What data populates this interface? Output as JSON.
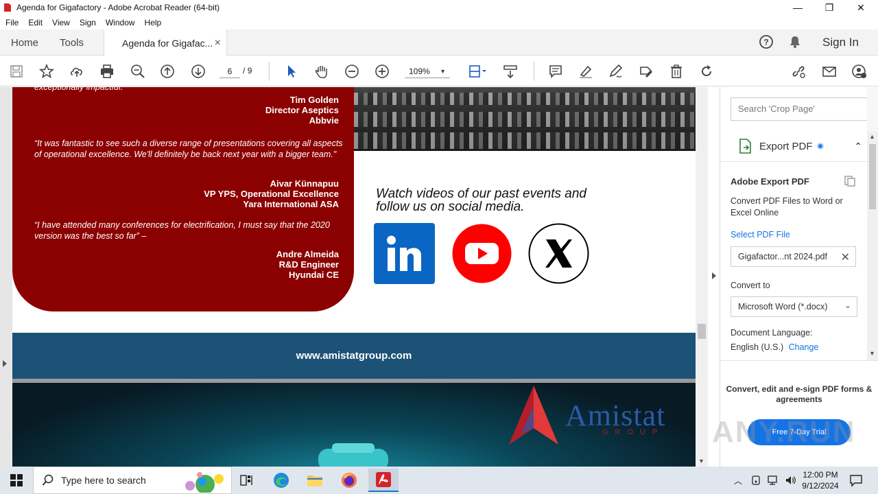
{
  "window": {
    "title": "Agenda for Gigafactory - Adobe Acrobat Reader (64-bit)",
    "minimize": "—",
    "maximize": "❐",
    "close": "✕"
  },
  "menu": [
    "File",
    "Edit",
    "View",
    "Sign",
    "Window",
    "Help"
  ],
  "tabs": {
    "home": "Home",
    "tools": "Tools",
    "document": "Agenda for Gigafac...",
    "close": "×",
    "sign_in": "Sign In"
  },
  "toolbar": {
    "current_page": "6",
    "page_separator": "/",
    "total_pages": "9",
    "zoom": "109%"
  },
  "document": {
    "partial_quote": "exceptionally impactful.",
    "testimonials": [
      {
        "quote": "",
        "name": "Tim Golden",
        "title": "Director Aseptics",
        "company": "Abbvie"
      },
      {
        "quote": "“It was fantastic to see such a diverse range of presentations covering all aspects of operational excellence. We'll definitely be back next year with a bigger team.\"",
        "name": "Aivar Künnapuu",
        "title": "VP YPS, Operational Excellence",
        "company": "Yara International ASA"
      },
      {
        "quote": "“I have attended many conferences for electrification, I must say that the 2020 version was the best so far” –",
        "name": "Andre Almeida",
        "title": "R&D Engineer",
        "company": "Hyundai CE"
      }
    ],
    "watch_line1": "Watch videos of our past events and",
    "watch_line2": "follow us on social media.",
    "social": [
      "linkedin-icon",
      "youtube-icon",
      "x-icon"
    ],
    "website": "www.amistatgroup.com",
    "logo_name": "Amistat",
    "logo_sub": "GROUP"
  },
  "right_panel": {
    "search_placeholder": "Search 'Crop Page'",
    "export_header": "Export PDF",
    "title": "Adobe Export PDF",
    "description": "Convert PDF Files to Word or Excel Online",
    "select_link": "Select PDF File",
    "file_name": "Gigafactor...nt 2024.pdf",
    "convert_to_label": "Convert to",
    "convert_to_value": "Microsoft Word (*.docx)",
    "doc_language_label": "Document Language:",
    "doc_language_value": "English (U.S.)",
    "change_link": "Change",
    "promo_text": "Convert, edit and e-sign PDF forms & agreements",
    "trial_button": "Free 7-Day Trial"
  },
  "watermark": "ANY.RUN",
  "taskbar": {
    "search_placeholder": "Type here to search",
    "time": "12:00 PM",
    "date": "9/12/2024"
  },
  "colors": {
    "red_panel": "#8b0000",
    "footer_band": "#1c5276",
    "accent": "#1473e6"
  }
}
